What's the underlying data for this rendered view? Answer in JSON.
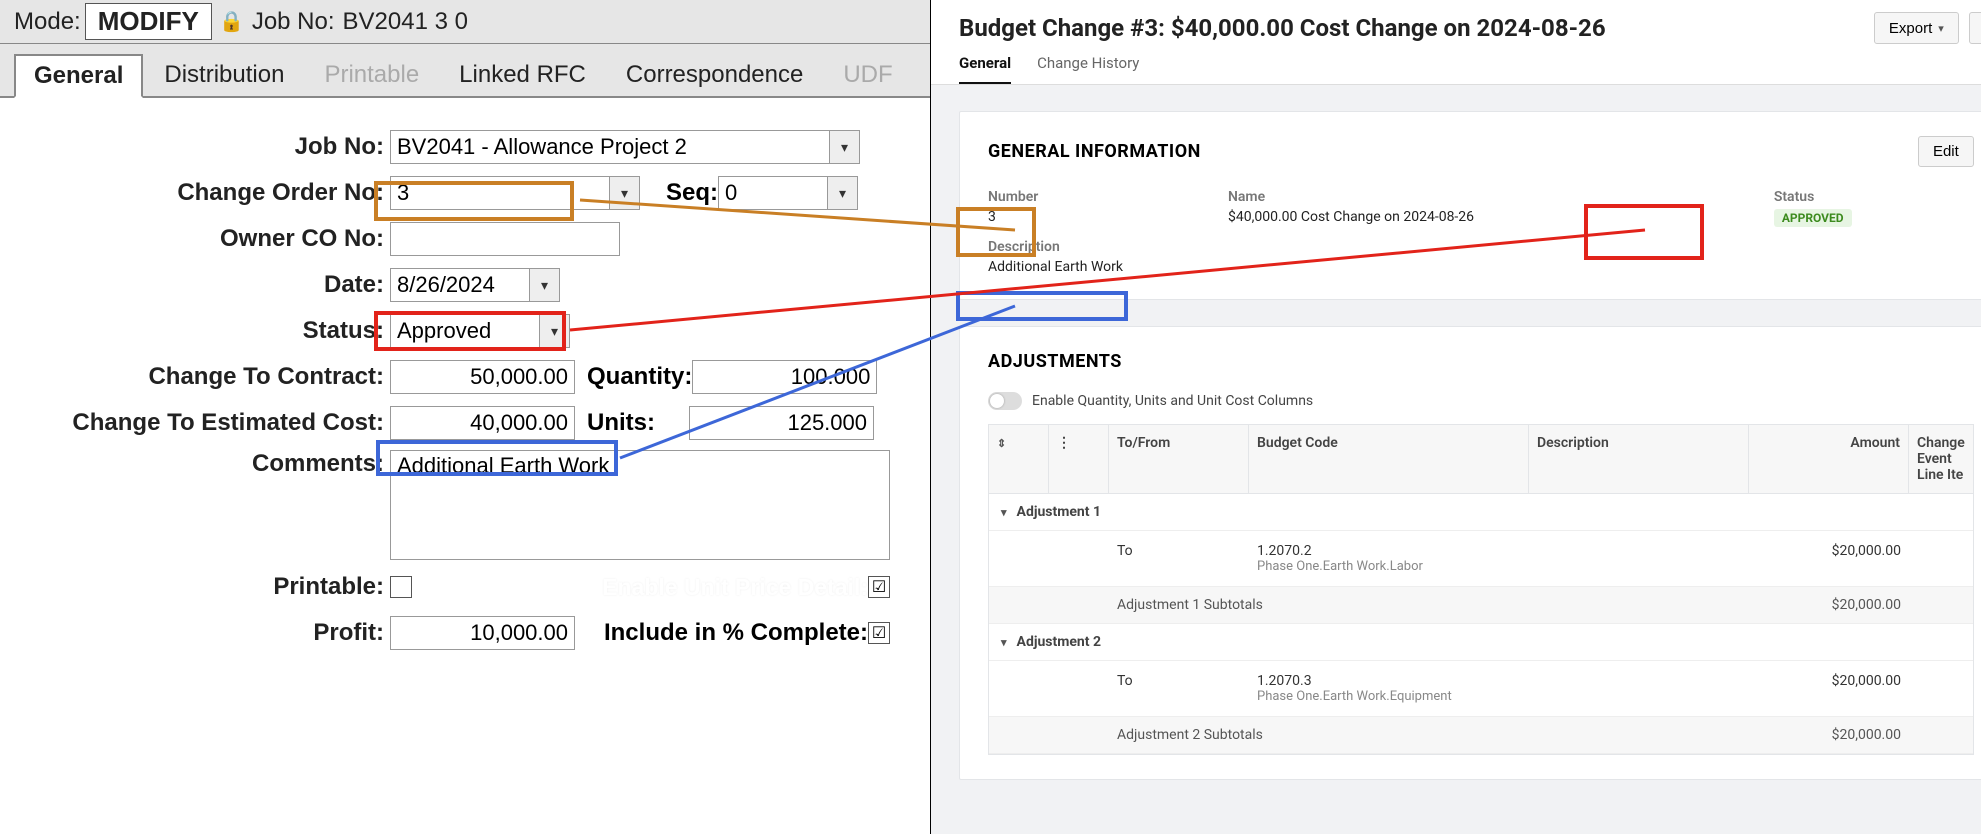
{
  "left": {
    "mode_label": "Mode:",
    "mode_value": "MODIFY",
    "jobno_label": "Job No:",
    "jobno_header": "BV2041  3  0",
    "tabs": [
      "General",
      "Distribution",
      "Printable",
      "Linked RFC",
      "Correspondence",
      "UDF"
    ],
    "tabs_disabled": [
      false,
      false,
      true,
      false,
      false,
      true
    ],
    "form": {
      "jobno": {
        "label": "Job No:",
        "value": "BV2041 - Allowance Project 2"
      },
      "change_order_no": {
        "label": "Change Order No:",
        "value": "3"
      },
      "seq": {
        "label": "Seq:",
        "value": "0"
      },
      "owner_co_no": {
        "label": "Owner CO No:",
        "value": ""
      },
      "date": {
        "label": "Date:",
        "value": "8/26/2024"
      },
      "status": {
        "label": "Status:",
        "value": "Approved"
      },
      "change_to_contract": {
        "label": "Change To Contract:",
        "value": "50,000.00"
      },
      "quantity": {
        "label": "Quantity:",
        "value": "100.000"
      },
      "change_to_est_cost": {
        "label": "Change To Estimated Cost:",
        "value": "40,000.00"
      },
      "units": {
        "label": "Units:",
        "value": "125.000"
      },
      "comments": {
        "label": "Comments:",
        "value": "Additional Earth Work"
      },
      "printable": {
        "label": "Printable:",
        "checked": false
      },
      "enable_unit_price": {
        "label": "Enable Unit Price Detail:",
        "checked": true
      },
      "profit": {
        "label": "Profit:",
        "value": "10,000.00"
      },
      "include_in_percent": {
        "label": "Include in % Complete:",
        "checked": true
      }
    }
  },
  "right": {
    "title": "Budget Change #3: $40,000.00 Cost Change on 2024-08-26",
    "export_label": "Export",
    "tabs": [
      "General",
      "Change History"
    ],
    "general_info": {
      "heading": "GENERAL INFORMATION",
      "edit_label": "Edit",
      "number_label": "Number",
      "number_value": "3",
      "name_label": "Name",
      "name_value": "$40,000.00 Cost Change on 2024-08-26",
      "status_label": "Status",
      "status_value": "APPROVED",
      "description_label": "Description",
      "description_value": "Additional Earth Work"
    },
    "adjustments": {
      "heading": "ADJUSTMENTS",
      "toggle_label": "Enable Quantity, Units and Unit Cost Columns",
      "columns": {
        "tofrom": "To/From",
        "code": "Budget Code",
        "desc": "Description",
        "amount": "Amount",
        "cel": "Change Event Line Ite"
      },
      "groups": [
        {
          "name": "Adjustment 1",
          "rows": [
            {
              "tofrom": "To",
              "code1": "1.2070.2",
              "code2": "Phase One.Earth Work.Labor",
              "desc": "",
              "amount": "$20,000.00"
            }
          ],
          "subtotal_label": "Adjustment 1 Subtotals",
          "subtotal": "$20,000.00"
        },
        {
          "name": "Adjustment 2",
          "rows": [
            {
              "tofrom": "To",
              "code1": "1.2070.3",
              "code2": "Phase One.Earth Work.Equipment",
              "desc": "",
              "amount": "$20,000.00"
            }
          ],
          "subtotal_label": "Adjustment 2 Subtotals",
          "subtotal": "$20,000.00"
        }
      ]
    }
  },
  "annotation_colors": {
    "orange": "#c97f25",
    "red": "#e2231a",
    "blue": "#3d67d8"
  }
}
